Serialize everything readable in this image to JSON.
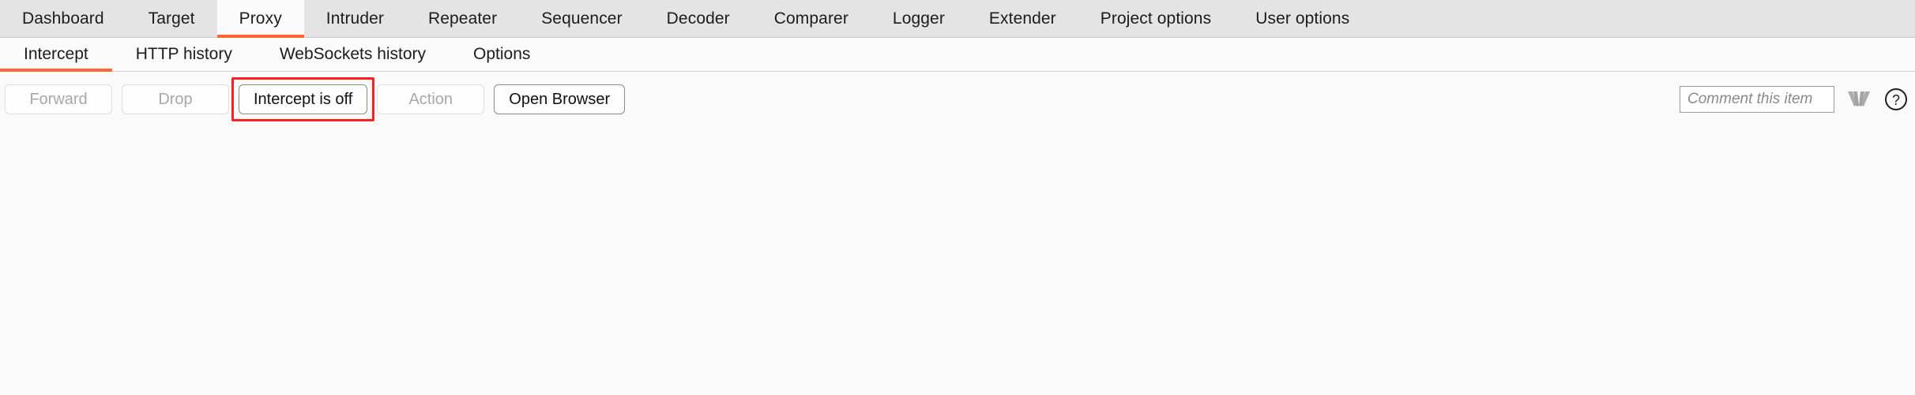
{
  "theme": {
    "accent": "#ff6633",
    "highlight": "#fe2020",
    "tabbar_bg": "#e4e4e4",
    "panel_bg": "#fafafa",
    "text": "#1c1c1c",
    "disabled_text": "#a8a8a8"
  },
  "main_tabs": [
    {
      "label": "Dashboard",
      "active": false
    },
    {
      "label": "Target",
      "active": false
    },
    {
      "label": "Proxy",
      "active": true
    },
    {
      "label": "Intruder",
      "active": false
    },
    {
      "label": "Repeater",
      "active": false
    },
    {
      "label": "Sequencer",
      "active": false
    },
    {
      "label": "Decoder",
      "active": false
    },
    {
      "label": "Comparer",
      "active": false
    },
    {
      "label": "Logger",
      "active": false
    },
    {
      "label": "Extender",
      "active": false
    },
    {
      "label": "Project options",
      "active": false
    },
    {
      "label": "User options",
      "active": false
    }
  ],
  "sub_tabs": [
    {
      "label": "Intercept",
      "active": true
    },
    {
      "label": "HTTP history",
      "active": false
    },
    {
      "label": "WebSockets history",
      "active": false
    },
    {
      "label": "Options",
      "active": false
    }
  ],
  "toolbar": {
    "forward_label": "Forward",
    "drop_label": "Drop",
    "intercept_toggle_label": "Intercept is off",
    "action_label": "Action",
    "open_browser_label": "Open Browser",
    "comment_placeholder": "Comment this item",
    "comment_value": "",
    "expand_icon": "fan-chevron-down-icon",
    "help_icon": "help-question-icon"
  }
}
